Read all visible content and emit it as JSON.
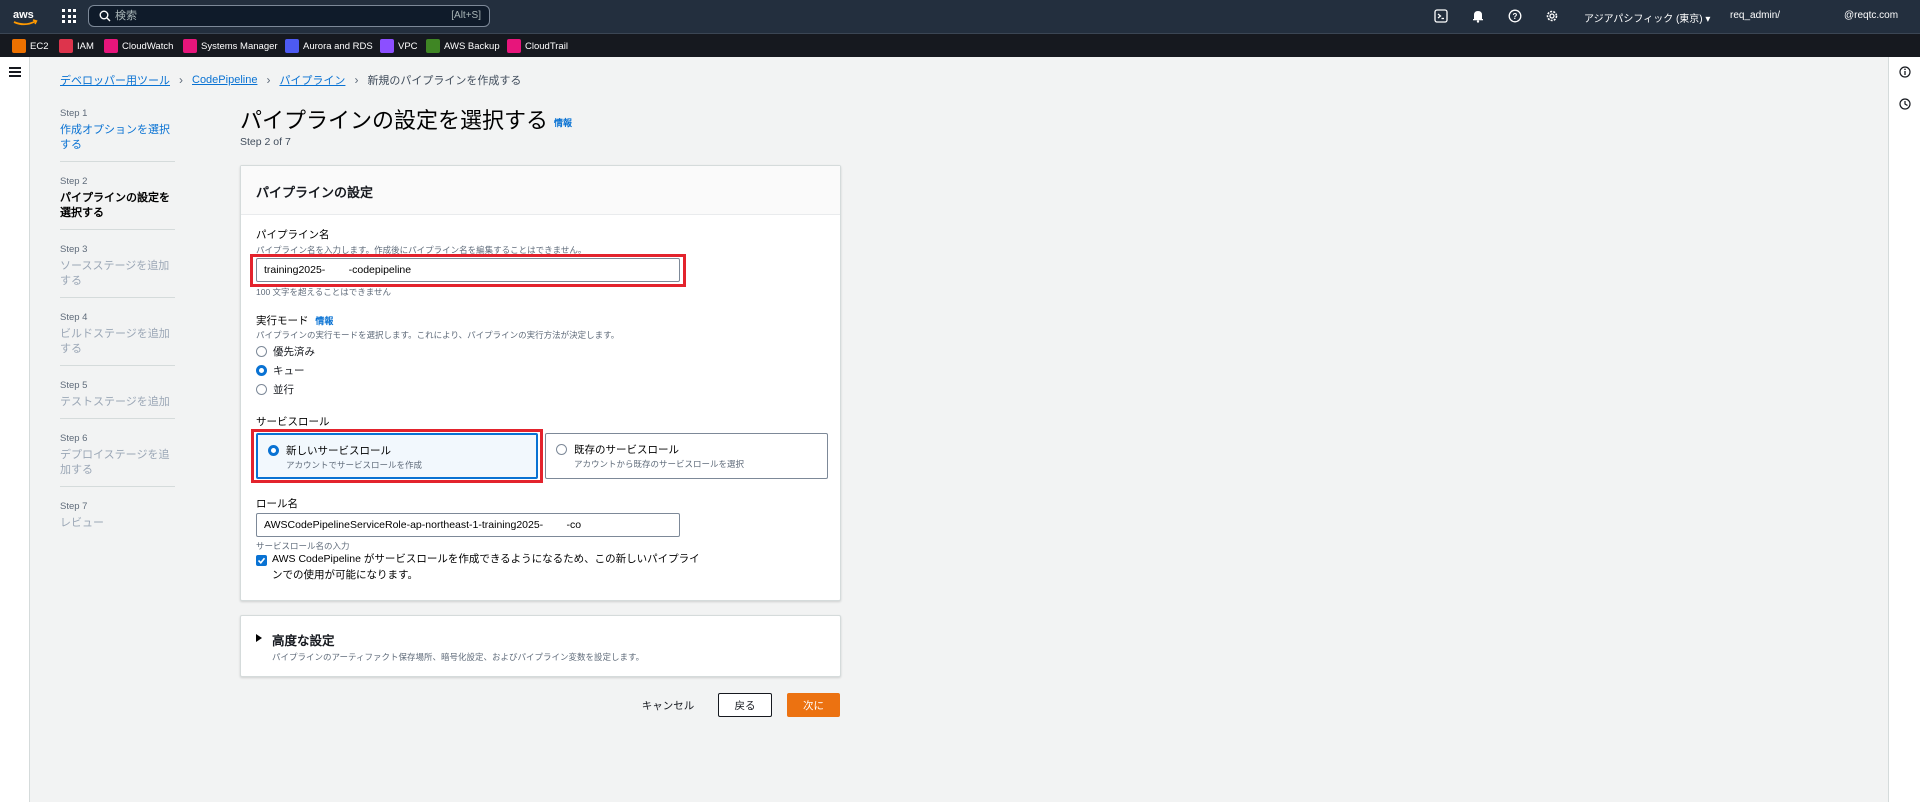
{
  "topnav": {
    "search_placeholder": "検索",
    "search_shortcut": "[Alt+S]",
    "region": "アジアパシフィック (東京) ▾",
    "account": "req_admin/",
    "account_domain": "@reqtc.com"
  },
  "favorites": [
    {
      "label": "EC2",
      "color": "#ed7100"
    },
    {
      "label": "IAM",
      "color": "#dd344c"
    },
    {
      "label": "CloudWatch",
      "color": "#e7157b"
    },
    {
      "label": "Systems Manager",
      "color": "#e7157b"
    },
    {
      "label": "Aurora and RDS",
      "color": "#4d5af2"
    },
    {
      "label": "VPC",
      "color": "#8c4fff"
    },
    {
      "label": "AWS Backup",
      "color": "#3f8624"
    },
    {
      "label": "CloudTrail",
      "color": "#e7157b"
    }
  ],
  "breadcrumb": {
    "items": [
      "デベロッパー用ツール",
      "CodePipeline",
      "パイプライン"
    ],
    "current": "新規のパイプラインを作成する"
  },
  "steps": [
    {
      "label": "Step 1",
      "name": "作成オプションを選択する",
      "state": "link"
    },
    {
      "label": "Step 2",
      "name": "パイプラインの設定を選択する",
      "state": "active"
    },
    {
      "label": "Step 3",
      "name": "ソースステージを追加する",
      "state": "disabled"
    },
    {
      "label": "Step 4",
      "name": "ビルドステージを追加する",
      "state": "disabled"
    },
    {
      "label": "Step 5",
      "name": "テストステージを追加",
      "state": "disabled"
    },
    {
      "label": "Step 6",
      "name": "デプロイステージを追加する",
      "state": "disabled"
    },
    {
      "label": "Step 7",
      "name": "レビュー",
      "state": "disabled"
    }
  ],
  "page": {
    "title": "パイプラインの設定を選択する",
    "info": "情報",
    "step_of": "Step 2 of 7"
  },
  "panel": {
    "header": "パイプラインの設定",
    "name_label": "パイプライン名",
    "name_desc": "パイプライン名を入力します。作成後にパイプライン名を編集することはできません。",
    "name_value": "training2025-        -codepipeline",
    "name_constraint": "100 文字を超えることはできません",
    "mode_label": "実行モード",
    "mode_info": "情報",
    "mode_desc": "パイプラインの実行モードを選択します。これにより、パイプラインの実行方法が決定します。",
    "modes": [
      "優先済み",
      "キュー",
      "並行"
    ],
    "mode_selected_index": 1,
    "role_label": "サービスロール",
    "role_new_title": "新しいサービスロール",
    "role_new_desc": "アカウントでサービスロールを作成",
    "role_existing_title": "既存のサービスロール",
    "role_existing_desc": "アカウントから既存のサービスロールを選択",
    "rolename_label": "ロール名",
    "rolename_value": "AWSCodePipelineServiceRole-ap-northeast-1-training2025-        -co",
    "rolename_hint": "サービスロール名の入力",
    "allow_text": "AWS CodePipeline がサービスロールを作成できるようになるため、この新しいパイプラインでの使用が可能になります。",
    "allow_checked": true
  },
  "advanced": {
    "title": "高度な設定",
    "desc": "パイプラインのアーティファクト保存場所、暗号化設定、およびパイプライン変数を設定します。"
  },
  "buttons": {
    "cancel": "キャンセル",
    "back": "戻る",
    "next": "次に"
  },
  "colors": {
    "accent": "#0972d3",
    "primary_button": "#ec7211",
    "highlight": "#e3232d",
    "topnav_bg": "#232f3e"
  }
}
